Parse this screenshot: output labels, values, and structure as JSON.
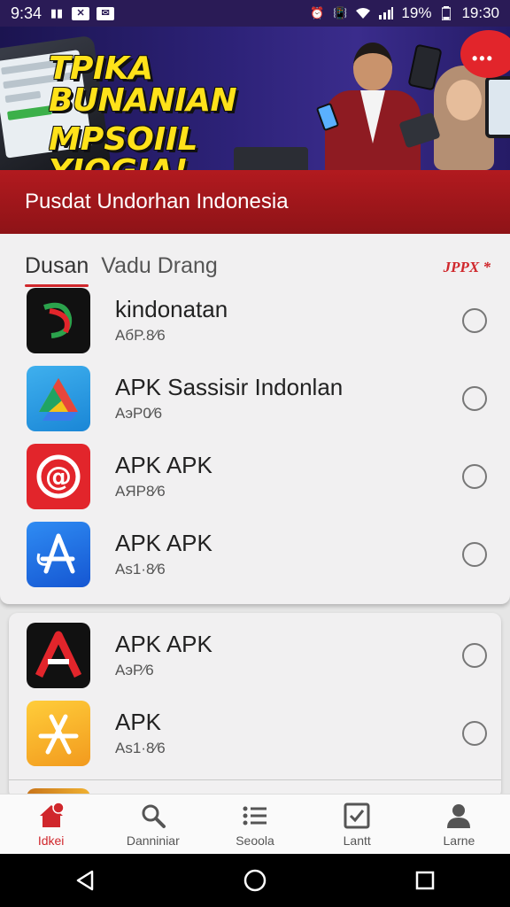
{
  "status_bar": {
    "time": "9:34",
    "battery": "19%",
    "clock": "19:30"
  },
  "banner": {
    "headline_line1": "TPIKA BUNANIAN",
    "headline_line2": "MPSOIIL YIOGIA!",
    "bubble": "•••"
  },
  "header": {
    "title": "Pusdat Undorhan Indonesia"
  },
  "tabs": [
    {
      "label": "Dusan",
      "active": true
    },
    {
      "label": "Vadu Drang",
      "active": false
    }
  ],
  "tab_tag": "JPPX *",
  "apps_primary": [
    {
      "title": "kindonatan",
      "subtitle": "AбP.8⁄6",
      "icon": "kindonatan-icon",
      "color": "#111111"
    },
    {
      "title": "APK Sassisir Indonlan",
      "subtitle": "AэP0⁄6",
      "icon": "drive-triangle-icon",
      "color": "#2ea0e0"
    },
    {
      "title": "APK APK",
      "subtitle": "AЯP8⁄6",
      "icon": "at-sign-icon",
      "color": "#e2252b"
    },
    {
      "title": "APK APK",
      "subtitle": "As1·8⁄6",
      "icon": "app-store-icon",
      "color": "#1e6fe0"
    }
  ],
  "apps_secondary": [
    {
      "title": "APK APK",
      "subtitle": "AэP⁄6",
      "icon": "letter-a-icon",
      "color": "#111111"
    },
    {
      "title": "APK",
      "subtitle": "As1·8⁄6",
      "icon": "app-store-yellow-icon",
      "color": "#f5a623"
    }
  ],
  "bottom_nav": [
    {
      "label": "Idkei",
      "icon": "home-icon",
      "active": true
    },
    {
      "label": "Danniniar",
      "icon": "search-icon",
      "active": false
    },
    {
      "label": "Seoola",
      "icon": "list-icon",
      "active": false
    },
    {
      "label": "Lantt",
      "icon": "checkbox-icon",
      "active": false
    },
    {
      "label": "Larne",
      "icon": "person-icon",
      "active": false
    }
  ]
}
